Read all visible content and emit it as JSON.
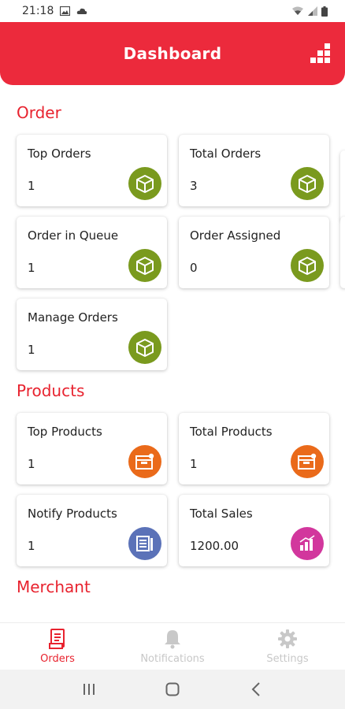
{
  "status_bar": {
    "time": "21:18",
    "icons": [
      "image-icon",
      "cloud-icon",
      "wifi-icon",
      "signal-icon",
      "battery-icon"
    ]
  },
  "header": {
    "title": "Dashboard",
    "menu_icon": "grid-stairs-icon"
  },
  "colors": {
    "primary": "#ec2a3c",
    "section_title": "#e8232f",
    "order_icon_bg": "#7a9a1e",
    "product_icon_bg": "#ea6a1a",
    "notify_icon_bg": "#5b72b8",
    "sales_icon_bg": "#d2379d"
  },
  "sections": {
    "order": {
      "title": "Order",
      "cards": [
        {
          "title": "Top Orders",
          "value": "1",
          "icon": "box-icon"
        },
        {
          "title": "Total Orders",
          "value": "3",
          "icon": "box-icon"
        },
        {
          "title": "Order in Queue",
          "value": "1",
          "icon": "box-icon"
        },
        {
          "title": "Order Assigned",
          "value": "0",
          "icon": "box-icon"
        },
        {
          "title": "Manage Orders",
          "value": "1",
          "icon": "box-icon"
        }
      ]
    },
    "products": {
      "title": "Products",
      "cards": [
        {
          "title": "Top Products",
          "value": "1",
          "icon": "product-box-icon"
        },
        {
          "title": "Total Products",
          "value": "1",
          "icon": "product-box-icon"
        },
        {
          "title": "Notify Products",
          "value": "1",
          "icon": "list-icon"
        },
        {
          "title": "Total Sales",
          "value": "1200.00",
          "icon": "bar-chart-icon"
        }
      ]
    },
    "merchant": {
      "title": "Merchant"
    }
  },
  "bottom_nav": [
    {
      "label": "Orders",
      "icon": "orders-icon",
      "active": true
    },
    {
      "label": "Notifications",
      "icon": "bell-icon",
      "active": false
    },
    {
      "label": "Settings",
      "icon": "gear-icon",
      "active": false
    }
  ],
  "system_nav": [
    "recents-icon",
    "home-icon",
    "back-icon"
  ]
}
